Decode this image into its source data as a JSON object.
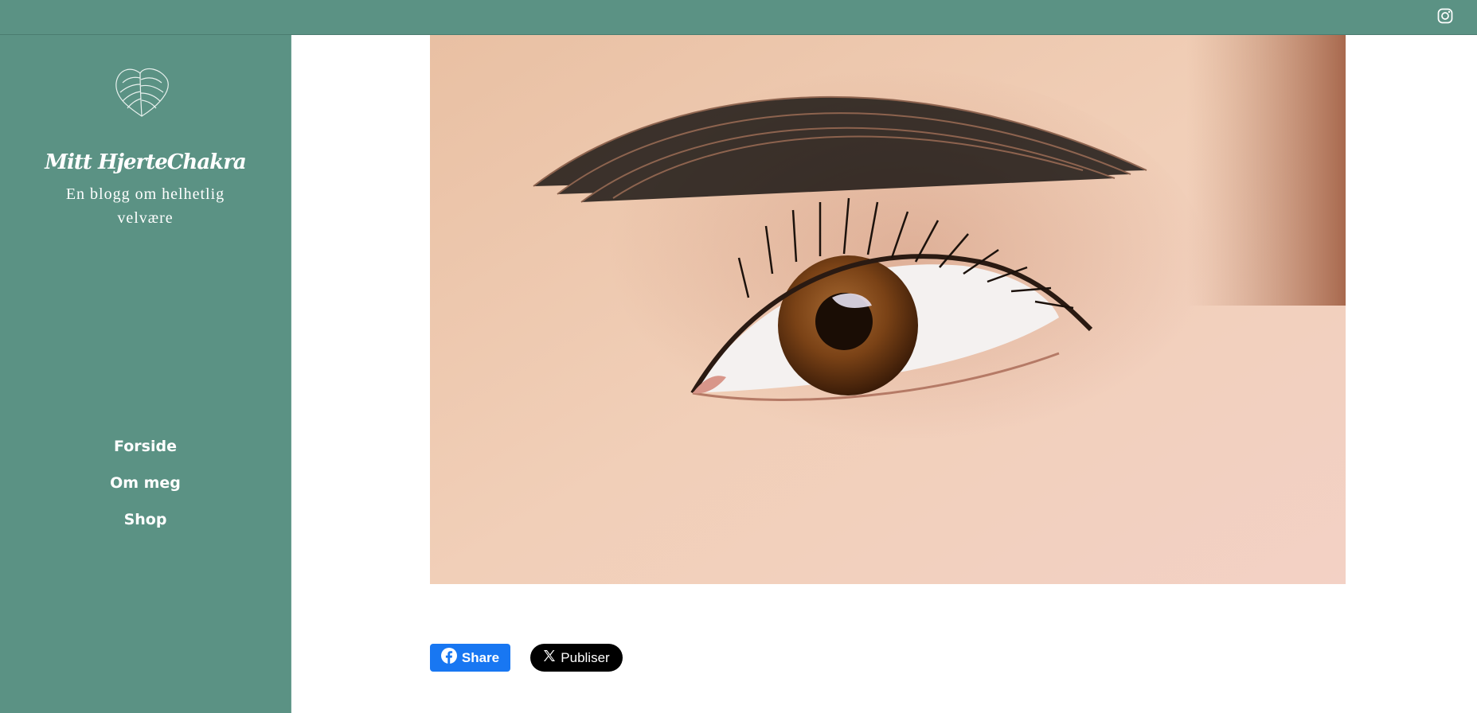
{
  "header": {
    "social_icon": "instagram-icon"
  },
  "sidebar": {
    "logo_icon": "heart-leaf-icon",
    "title": "Mitt HjerteChakra",
    "tagline": "En blogg om helhetlig velvære",
    "nav": [
      {
        "label": "Forside"
      },
      {
        "label": "Om meg"
      },
      {
        "label": "Shop"
      }
    ]
  },
  "main": {
    "hero_image": "close-up-brown-eye-photo",
    "share": {
      "facebook_label": "Share",
      "facebook_icon": "facebook-icon",
      "x_label": "Publiser",
      "x_icon": "x-logo-icon"
    }
  },
  "colors": {
    "sidebar_bg": "#5b9284",
    "facebook_blue": "#1877f2",
    "x_black": "#000000"
  }
}
